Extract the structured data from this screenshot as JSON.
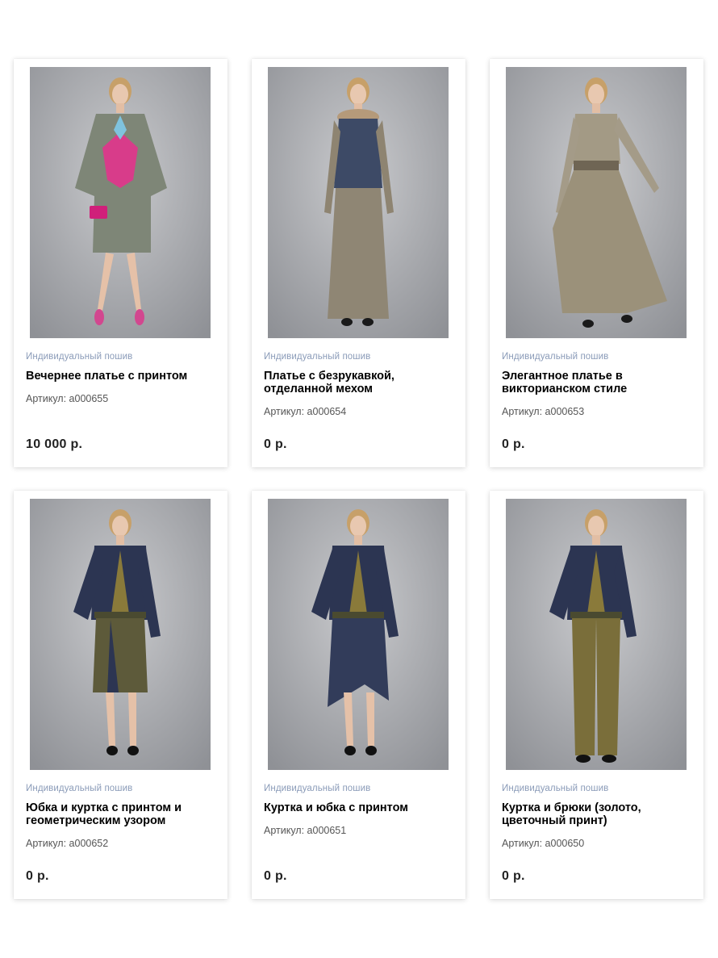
{
  "products": [
    {
      "category": "Индивидуальный пошив",
      "title": "Вечернее платье с принтом",
      "sku": "Артикул: a000655",
      "price": "10 000 р.",
      "outfit": "butterfly-dress",
      "colors": {
        "top": "#7e8677",
        "bottom": "#7e8677",
        "accent": "#d83c8a"
      }
    },
    {
      "category": "Индивидуальный пошив",
      "title": "Платье с безрукавкой, отделанной мехом",
      "sku": "Артикул: a000654",
      "price": "0 р.",
      "outfit": "fur-vest-dress",
      "colors": {
        "top": "#3d4a66",
        "bottom": "#8f8674",
        "accent": "#b59a7a"
      }
    },
    {
      "category": "Индивидуальный пошив",
      "title": "Элегантное платье в викторианском стиле",
      "sku": "Артикул: a000653",
      "price": "0 р.",
      "outfit": "victorian-dress",
      "colors": {
        "top": "#a39a85",
        "bottom": "#9b917a",
        "accent": "#6f6554"
      }
    },
    {
      "category": "Индивидуальный пошив",
      "title": "Юбка и куртка с принтом и геометрическим узором",
      "sku": "Артикул: a000652",
      "price": "0 р.",
      "outfit": "jacket-skirt",
      "colors": {
        "top": "#2c3552",
        "bottom": "#5d5a3a",
        "accent": "#8a7a3a"
      }
    },
    {
      "category": "Индивидуальный пошив",
      "title": "Куртка и юбка с принтом",
      "sku": "Артикул: a000651",
      "price": "0 р.",
      "outfit": "jacket-skirt-2",
      "colors": {
        "top": "#2c3552",
        "bottom": "#323c5a",
        "accent": "#8a7a3a"
      }
    },
    {
      "category": "Индивидуальный пошив",
      "title": "Куртка и брюки (золото, цветочный принт)",
      "sku": "Артикул: a000650",
      "price": "0 р.",
      "outfit": "jacket-trousers",
      "colors": {
        "top": "#2c3552",
        "bottom": "#7a6e3a",
        "accent": "#8a7a3a"
      }
    }
  ]
}
